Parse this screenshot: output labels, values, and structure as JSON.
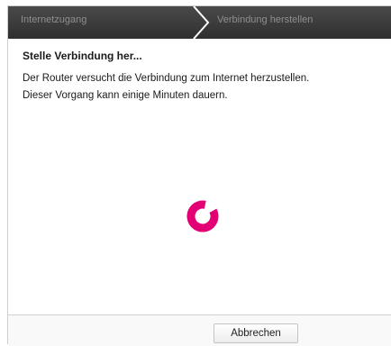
{
  "wizard": {
    "steps": [
      {
        "label": "Internetzugang"
      },
      {
        "label": "Verbindung herstellen"
      }
    ]
  },
  "content": {
    "heading": "Stelle Verbindung her...",
    "line1": "Der Router versucht die Verbindung zum Internet herzustellen.",
    "line2": "Dieser Vorgang kann einige Minuten dauern."
  },
  "spinner": {
    "icon": "loading-spinner-icon",
    "color": "#e20074"
  },
  "footer": {
    "cancel_label": "Abbrechen"
  }
}
